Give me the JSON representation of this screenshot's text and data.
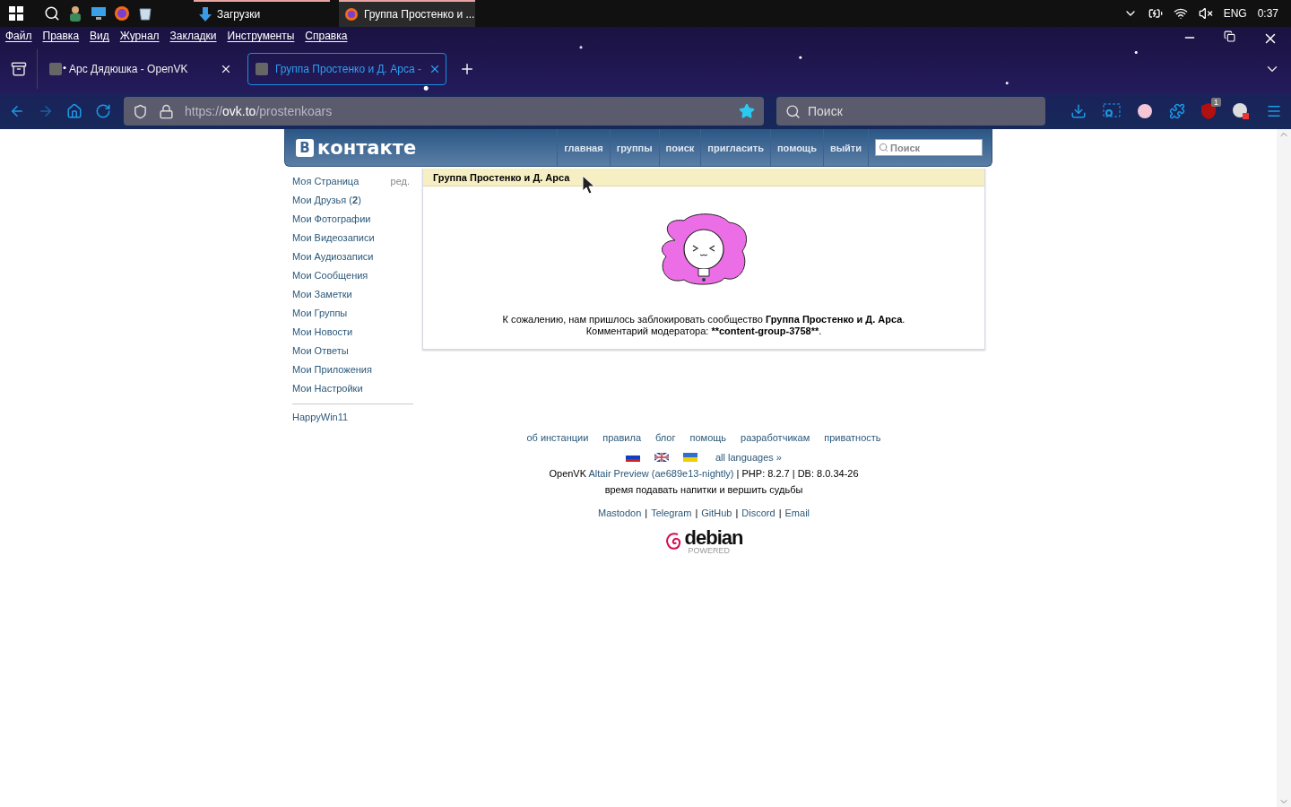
{
  "taskbar": {
    "buttons": [
      {
        "label": "Загрузки",
        "kind": "download",
        "active": false
      },
      {
        "label": "Группа Простенко и ...",
        "kind": "browser",
        "active": true
      }
    ],
    "tray": {
      "language": "ENG",
      "time": "0:37"
    }
  },
  "browser": {
    "menu": [
      "Файл",
      "Правка",
      "Вид",
      "Журнал",
      "Закладки",
      "Инструменты",
      "Справка"
    ],
    "tabs": [
      {
        "title": "Арс Дядюшка - OpenVK",
        "selected": false
      },
      {
        "title": "Группа Простенко и Д. Арса -",
        "selected": true
      }
    ],
    "url": {
      "scheme": "https://",
      "domain": "ovk.to",
      "path": "/prostenkoars"
    },
    "search": {
      "placeholder": "Поиск"
    },
    "extension_badge": "1"
  },
  "header": {
    "logo_letter": "В",
    "logo_text": "контакте",
    "nav": [
      "главная",
      "группы",
      "поиск",
      "пригласить",
      "помощь",
      "выйти"
    ],
    "search": {
      "placeholder": "Поиск"
    }
  },
  "sidebar": {
    "edit_link": "ред.",
    "items": [
      "Моя Страница",
      "Мои Друзья (**2**)",
      "Мои Фотографии",
      "Мои Видеозаписи",
      "Мои Аудиозаписи",
      "Мои Сообщения",
      "Мои Заметки",
      "Мои Группы",
      "Мои Новости",
      "Мои Ответы",
      "Мои Приложения",
      "Мои Настройки"
    ],
    "extra": [
      "HappyWin11"
    ]
  },
  "content": {
    "title": "Группа Простенко и Д. Арса",
    "message": "К сожалению, нам пришлось заблокировать сообщество **Группа Простенко и Д. Арса**.",
    "comment": {
      "label": "Комментарий модератора:",
      "value": "**content-group-3758**",
      "end": "."
    }
  },
  "footer": {
    "links": [
      "об инстанции",
      "правила",
      "блог",
      "помощь",
      "разработчикам",
      "приватность"
    ],
    "languages": [
      {
        "kind": "ru"
      },
      {
        "kind": "gb"
      },
      {
        "kind": "ua"
      }
    ],
    "all_languages": "all languages »",
    "version": {
      "name": "OpenVK",
      "link": "Altair Preview (ae689e13-nightly)",
      "rest": "| PHP: 8.2.7 | DB: 8.0.34-26"
    },
    "slogan": "время подавать напитки и вершить судьбы",
    "social": [
      "Mastodon",
      "Telegram",
      "GitHub",
      "Discord",
      "Email"
    ],
    "social_separator": "|",
    "powered": {
      "name": "debian",
      "sub": "POWERED"
    }
  }
}
